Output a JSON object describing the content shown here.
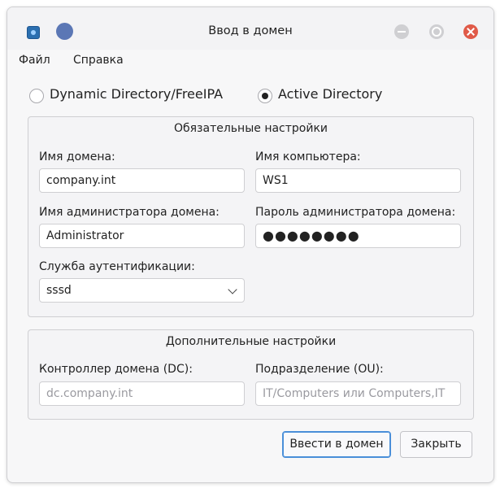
{
  "window": {
    "title": "Ввод в домен"
  },
  "menu": {
    "file": "Файл",
    "help": "Справка"
  },
  "mode": {
    "option1": "Dynamic Directory/FreeIPA",
    "option2": "Active Directory",
    "selected": "Active Directory"
  },
  "required": {
    "title": "Обязательные настройки",
    "domain_name_label": "Имя домена:",
    "domain_name_value": "company.int",
    "computer_name_label": "Имя компьютера:",
    "computer_name_value": "WS1",
    "admin_label": "Имя администратора домена:",
    "admin_value": "Administrator",
    "password_label": "Пароль администратора домена:",
    "password_value": "●●●●●●●●",
    "auth_label": "Служба аутентификации:",
    "auth_value": "sssd"
  },
  "optional": {
    "title": "Дополнительные настройки",
    "dc_label": "Контроллер домена (DC):",
    "dc_placeholder": "dc.company.int",
    "ou_label": "Подразделение (OU):",
    "ou_placeholder": "IT/Computers или Computers,IT"
  },
  "buttons": {
    "join": "Ввести в домен",
    "close": "Закрыть"
  },
  "colors": {
    "accent": "#4a8fd9",
    "close_button": "#e05a48"
  }
}
